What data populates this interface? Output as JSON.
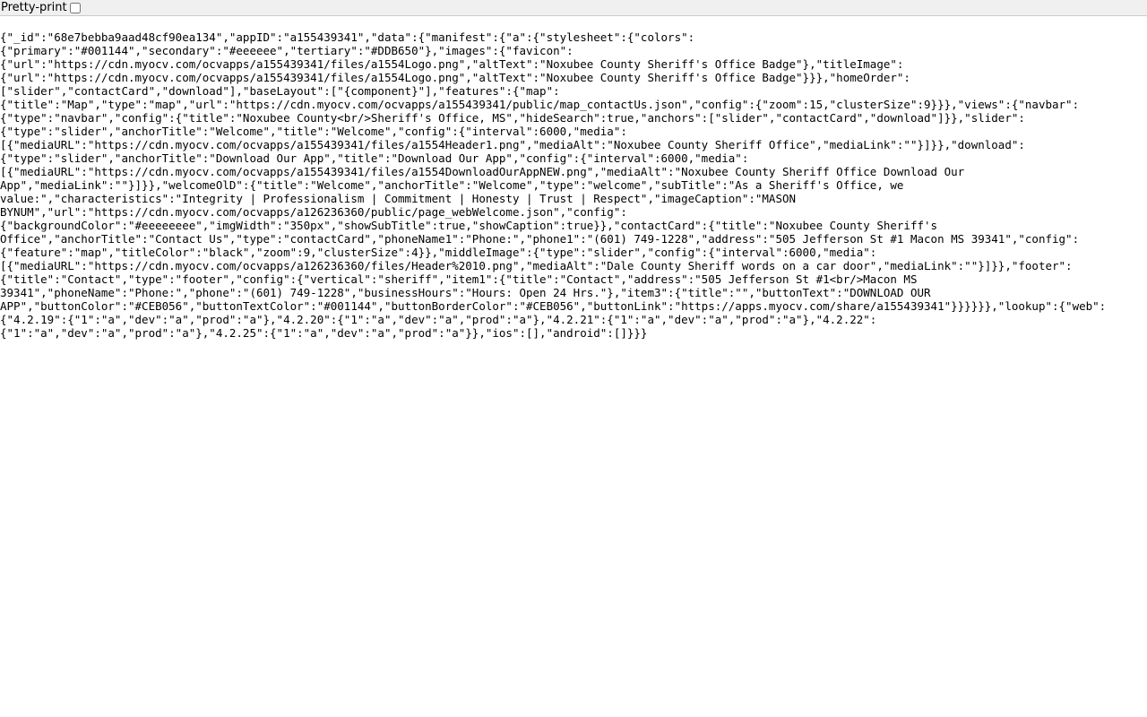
{
  "toolbar": {
    "pretty_print_label": "Pretty-print",
    "pretty_print_checked": false
  },
  "raw_json_text": "{\"_id\":\"68e7bebba9aad48cf90ea134\",\"appID\":\"a155439341\",\"data\":{\"manifest\":{\"a\":{\"stylesheet\":{\"colors\":{\"primary\":\"#001144\",\"secondary\":\"#eeeeee\",\"tertiary\":\"#DDB650\"},\"images\":{\"favicon\":{\"url\":\"https://cdn.myocv.com/ocvapps/a155439341/files/a1554Logo.png\",\"altText\":\"Noxubee County Sheriff's Office Badge\"},\"titleImage\":{\"url\":\"https://cdn.myocv.com/ocvapps/a155439341/files/a1554Logo.png\",\"altText\":\"Noxubee County Sheriff's Office Badge\"}}},\"homeOrder\":[\"slider\",\"contactCard\",\"download\"],\"baseLayout\":[\"{component}\"],\"features\":{\"map\":{\"title\":\"Map\",\"type\":\"map\",\"url\":\"https://cdn.myocv.com/ocvapps/a155439341/public/map_contactUs.json\",\"config\":{\"zoom\":15,\"clusterSize\":9}}},\"views\":{\"navbar\":{\"type\":\"navbar\",\"config\":{\"title\":\"Noxubee County<br/>Sheriff's Office, MS\",\"hideSearch\":true,\"anchors\":[\"slider\",\"contactCard\",\"download\"]}},\"slider\":{\"type\":\"slider\",\"anchorTitle\":\"Welcome\",\"title\":\"Welcome\",\"config\":{\"interval\":6000,\"media\":[{\"mediaURL\":\"https://cdn.myocv.com/ocvapps/a155439341/files/a1554Header1.png\",\"mediaAlt\":\"Noxubee County Sheriff Office\",\"mediaLink\":\"\"}]}},\"download\":{\"type\":\"slider\",\"anchorTitle\":\"Download Our App\",\"title\":\"Download Our App\",\"config\":{\"interval\":6000,\"media\":[{\"mediaURL\":\"https://cdn.myocv.com/ocvapps/a155439341/files/a1554DownloadOurAppNEW.png\",\"mediaAlt\":\"Noxubee County Sheriff Office Download Our App\",\"mediaLink\":\"\"}]}},\"welcomeOlD\":{\"title\":\"Welcome\",\"anchorTitle\":\"Welcome\",\"type\":\"welcome\",\"subTitle\":\"As a Sheriff's Office, we value:\",\"characteristics\":\"Integrity | Professionalism | Commitment | Honesty | Trust | Respect\",\"imageCaption\":\"MASON BYNUM\",\"url\":\"https://cdn.myocv.com/ocvapps/a126236360/public/page_webWelcome.json\",\"config\":{\"backgroundColor\":\"#eeeeeeee\",\"imgWidth\":\"350px\",\"showSubTitle\":true,\"showCaption\":true}},\"contactCard\":{\"title\":\"Noxubee County Sheriff's Office\",\"anchorTitle\":\"Contact Us\",\"type\":\"contactCard\",\"phoneName1\":\"Phone:\",\"phone1\":\"(601) 749-1228\",\"address\":\"505 Jefferson St #1 Macon MS 39341\",\"config\":{\"feature\":\"map\",\"titleColor\":\"black\",\"zoom\":9,\"clusterSize\":4}},\"middleImage\":{\"type\":\"slider\",\"config\":{\"interval\":6000,\"media\":[{\"mediaURL\":\"https://cdn.myocv.com/ocvapps/a126236360/files/Header%2010.png\",\"mediaAlt\":\"Dale County Sheriff words on a car door\",\"mediaLink\":\"\"}]}},\"footer\":{\"title\":\"Contact\",\"type\":\"footer\",\"config\":{\"vertical\":\"sheriff\",\"item1\":{\"title\":\"Contact\",\"address\":\"505 Jefferson St #1<br/>Macon MS 39341\",\"phoneName\":\"Phone:\",\"phone\":\"(601) 749-1228\",\"businessHours\":\"Hours: Open 24 Hrs.\"},\"item3\":{\"title\":\"\",\"buttonText\":\"DOWNLOAD OUR APP\",\"buttonColor\":\"#CEB056\",\"buttonTextColor\":\"#001144\",\"buttonBorderColor\":\"#CEB056\",\"buttonLink\":\"https://apps.myocv.com/share/a155439341\"}}}}}},\"lookup\":{\"web\":{\"4.2.19\":{\"1\":\"a\",\"dev\":\"a\",\"prod\":\"a\"},\"4.2.20\":{\"1\":\"a\",\"dev\":\"a\",\"prod\":\"a\"},\"4.2.21\":{\"1\":\"a\",\"dev\":\"a\",\"prod\":\"a\"},\"4.2.22\":{\"1\":\"a\",\"dev\":\"a\",\"prod\":\"a\"},\"4.2.25\":{\"1\":\"a\",\"dev\":\"a\",\"prod\":\"a\"}},\"ios\":[],\"android\":[]}}}"
}
